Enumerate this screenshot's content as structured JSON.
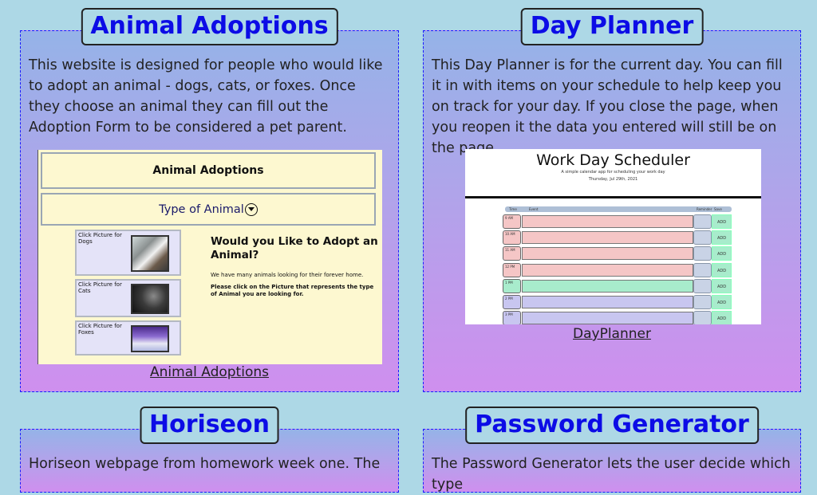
{
  "cards": {
    "animal": {
      "title": "Animal Adoptions",
      "description": "This website is designed for people who would like to adopt an animal - dogs, cats, or foxes. Once they choose an animal they can fill out the Adoption Form to be considered a pet parent.",
      "link": "Animal Adoptions",
      "screenshot": {
        "header": "Animal Adoptions",
        "dropdown": "Type of Animal",
        "tiles": [
          {
            "label": "Click Picture for Dogs"
          },
          {
            "label": "Click Picture for Cats"
          },
          {
            "label": "Click Picture for Foxes"
          }
        ],
        "heading": "Would you Like to Adopt an Animal?",
        "text1": "We have many animals looking for their forever home.",
        "text2": "Please click on the Picture that represents the type of Animal you are looking for."
      }
    },
    "planner": {
      "title": "Day Planner",
      "description": "This Day Planner is for the current day. You can fill it in with items on your schedule to help keep you on track for your day. If you close the page, when you reopen it the data you entered will still be on the page.",
      "link": "DayPlanner",
      "screenshot": {
        "title": "Work Day Scheduler",
        "subtitle": "A simple calendar app for scheduling your work day",
        "date": "Thursday, Jul 29th, 2021",
        "columns": {
          "time": "Time",
          "event": "Event",
          "reminder": "Reminder",
          "save": "Save"
        },
        "add_label": "ADD",
        "rows": [
          {
            "time": "9 AM",
            "color": "#f5c6c6"
          },
          {
            "time": "10 AM",
            "color": "#f5c6c6"
          },
          {
            "time": "11 AM",
            "color": "#f5c6c6"
          },
          {
            "time": "12 PM",
            "color": "#f5c6c6"
          },
          {
            "time": "1 PM",
            "color": "#a8eccc"
          },
          {
            "time": "2 PM",
            "color": "#c8c6f0"
          },
          {
            "time": "3 PM",
            "color": "#c8c6f0"
          }
        ]
      }
    },
    "horiseon": {
      "title": "Horiseon",
      "description": "Horiseon webpage from homework week one. The"
    },
    "password": {
      "title": "Password Generator",
      "description": "The Password Generator lets the user decide which type"
    }
  },
  "colors": {
    "background": "#add8e6",
    "title": "#0c0ce6",
    "border": "#1a1aff"
  }
}
